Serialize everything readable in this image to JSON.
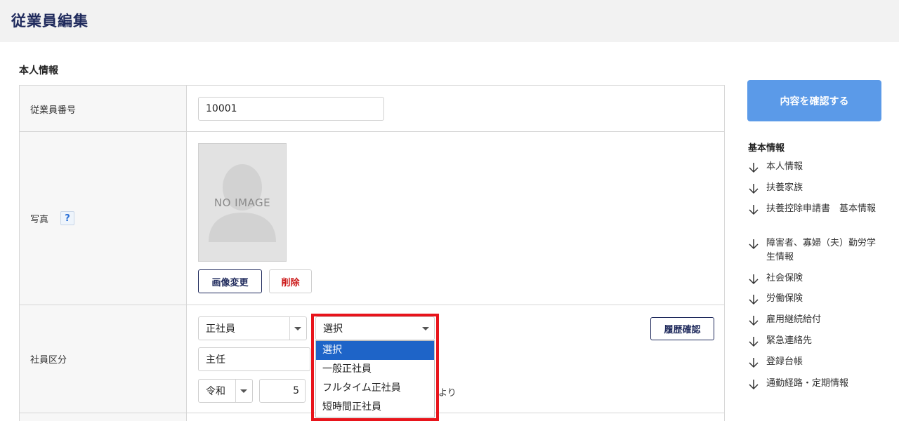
{
  "header": {
    "title": "従業員編集"
  },
  "section": {
    "title": "本人情報"
  },
  "rows": {
    "employee_number": {
      "label": "従業員番号",
      "value": "10001"
    },
    "photo": {
      "label": "写真",
      "help": "?",
      "no_image": "NO IMAGE",
      "change_button": "画像変更",
      "delete_button": "削除"
    },
    "employee_type": {
      "label": "社員区分",
      "type_select": "正社員",
      "sub_select": "選択",
      "history_button": "履歴確認",
      "position_value": "主任",
      "era_select": "令和",
      "year_value": "5",
      "suffix_text": "より",
      "options": [
        "選択",
        "一般正社員",
        "フルタイム正社員",
        "短時間正社員"
      ],
      "selected_option": "選択"
    }
  },
  "sidebar": {
    "confirm_button": "内容を確認する",
    "heading": "基本情報",
    "links": [
      "本人情報",
      "扶養家族",
      "扶養控除申請書　基本情報",
      "障害者、寡婦（夫）勤労学生情報",
      "社会保険",
      "労働保険",
      "雇用継続給付",
      "緊急連絡先",
      "登録台帳",
      "通勤経路・定期情報"
    ]
  },
  "colors": {
    "title": "#1f2a5c",
    "confirm_button_bg": "#5b9ae8",
    "selected_option_bg": "#1e64c8",
    "highlight_border": "#e8141b",
    "delete_text": "#cc1a1a"
  }
}
